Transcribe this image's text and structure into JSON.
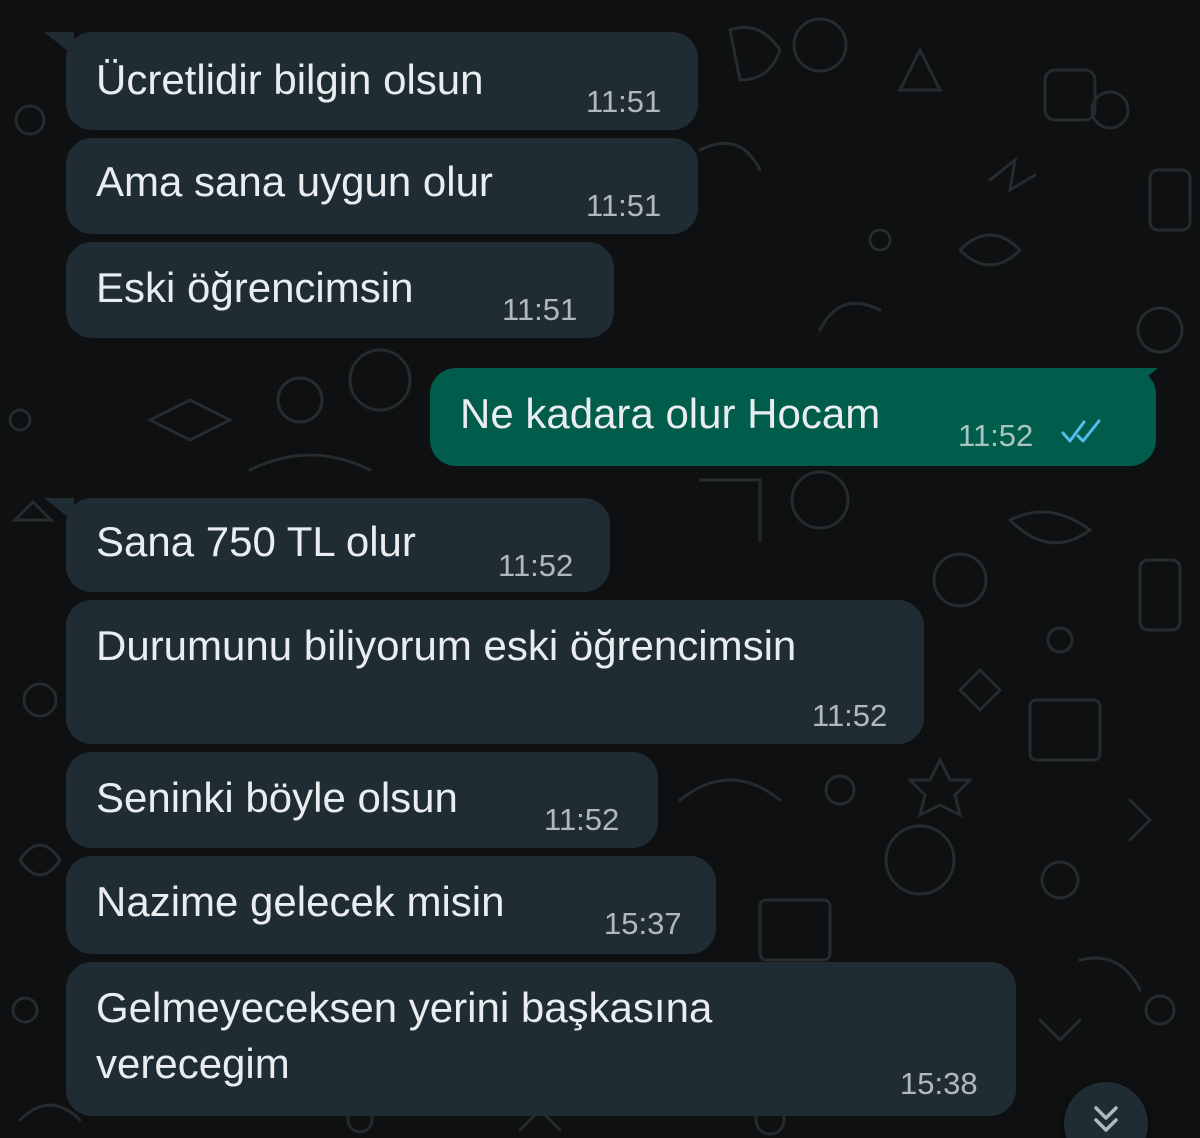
{
  "colors": {
    "background": "#0e1011",
    "incoming_bubble": "#202c33",
    "outgoing_bubble": "#005c4b",
    "text": "#e9edef",
    "read_ticks": "#53bdeb"
  },
  "messages": [
    {
      "direction": "incoming",
      "text": "Ücretlidir bilgin olsun",
      "time": "11:51"
    },
    {
      "direction": "incoming",
      "text": "Ama sana uygun olur",
      "time": "11:51"
    },
    {
      "direction": "incoming",
      "text": "Eski öğrencimsin",
      "time": "11:51"
    },
    {
      "direction": "outgoing",
      "text": "Ne kadara olur Hocam",
      "time": "11:52",
      "status_icon": "double-check-read-icon"
    },
    {
      "direction": "incoming",
      "text": "Sana 750 TL olur",
      "time": "11:52"
    },
    {
      "direction": "incoming",
      "text": "Durumunu biliyorum eski öğrencimsin",
      "time": "11:52"
    },
    {
      "direction": "incoming",
      "text": "Seninki böyle olsun",
      "time": "11:52"
    },
    {
      "direction": "incoming",
      "text": "Nazime gelecek misin",
      "time": "15:37"
    },
    {
      "direction": "incoming",
      "text": "Gelmeyeceksen yerini başkasına\nverecegim",
      "time": "15:38"
    }
  ],
  "scroll_button_icon": "chevron-double-down-icon"
}
